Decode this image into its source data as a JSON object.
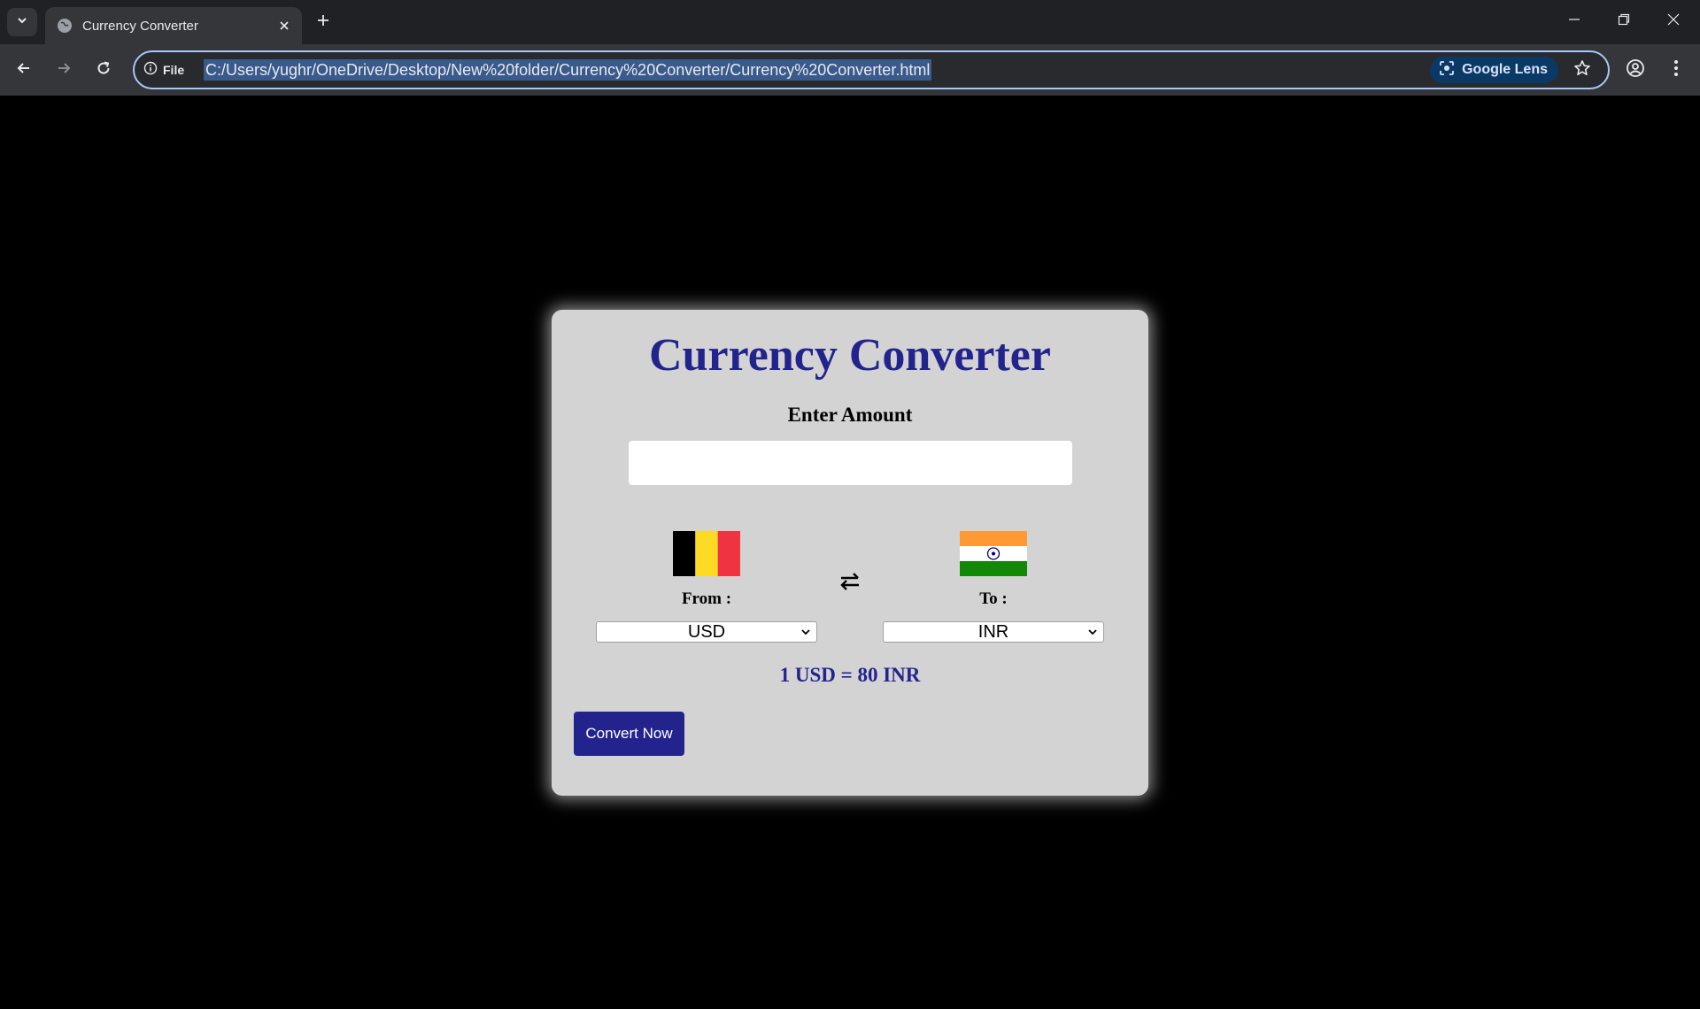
{
  "browser": {
    "tab_title": "Currency Converter",
    "site_info_label": "File",
    "url": "C:/Users/yughr/OneDrive/Desktop/New%20folder/Currency%20Converter/Currency%20Converter.html",
    "lens_label": "Google Lens"
  },
  "page": {
    "title": "Currency Converter",
    "amount_label": "Enter Amount",
    "amount_value": "",
    "from": {
      "label": "From :",
      "selected": "USD",
      "flag": "belgium-flag"
    },
    "to": {
      "label": "To :",
      "selected": "INR",
      "flag": "india-flag"
    },
    "swap_icon": "swap-arrows-icon",
    "rate_text": "1 USD = 80 INR",
    "convert_label": "Convert Now"
  },
  "colors": {
    "page_background": "#000000",
    "card_background": "#d3d3d3",
    "accent": "#23238e"
  }
}
